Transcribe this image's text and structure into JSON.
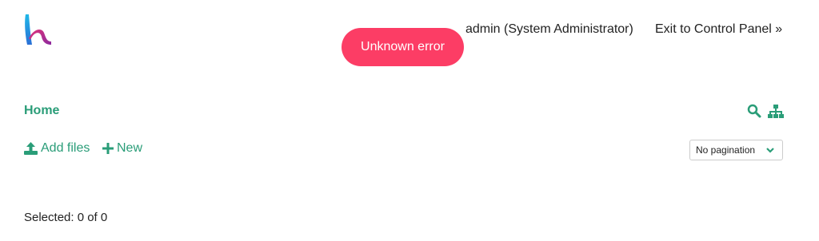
{
  "header": {
    "user_label": "admin (System Administrator)",
    "exit_label": "Exit to Control Panel »"
  },
  "toast": {
    "message": "Unknown error",
    "color": "#fc3d65"
  },
  "breadcrumb": {
    "home_label": "Home"
  },
  "toolbar": {
    "add_files_label": "Add files",
    "new_label": "New",
    "search_icon": "search-icon",
    "tree_icon": "sitemap-icon"
  },
  "pagination": {
    "selected_value": "No pagination"
  },
  "status": {
    "selected_text": "Selected: 0 of 0"
  },
  "colors": {
    "accent": "#2a9d78",
    "text": "#222222"
  }
}
